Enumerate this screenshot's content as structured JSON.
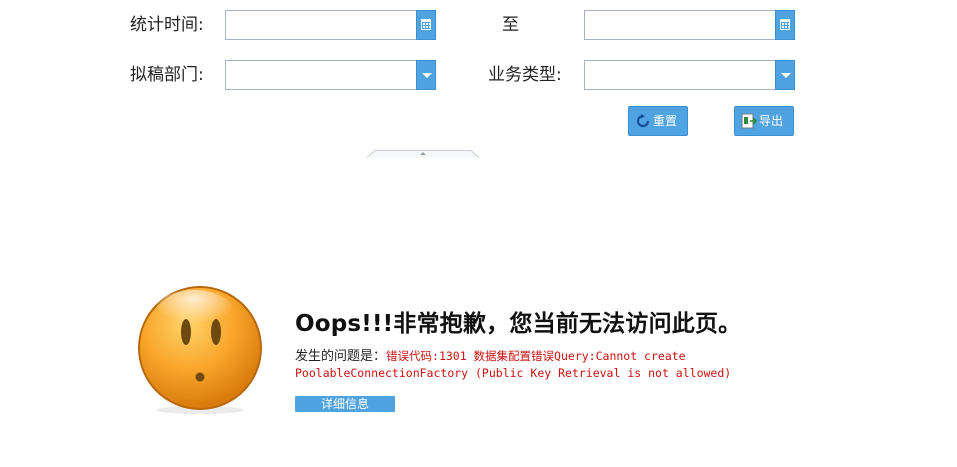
{
  "form": {
    "stat_time_label": "统计时间:",
    "to_label": "至",
    "dept_label": "拟稿部门:",
    "biz_type_label": "业务类型:",
    "start_date_value": "",
    "end_date_value": "",
    "dept_value": "",
    "biz_type_value": ""
  },
  "actions": {
    "reset_label": "重置",
    "export_label": "导出"
  },
  "error": {
    "title": "Oops!!!非常抱歉，您当前无法访问此页。",
    "problem_label": "发生的问题是：",
    "problem_text": "错误代码:1301 数据集配置错误Query:Cannot create PoolableConnectionFactory (Public Key Retrieval is not allowed)",
    "detail_button": "详细信息"
  },
  "colors": {
    "accent": "#4fa3e0",
    "error_text": "#cc1111"
  },
  "icons": {
    "calendar": "calendar-icon",
    "dropdown": "chevron-down-icon",
    "reset": "refresh-icon",
    "export": "export-icon",
    "collapse": "collapse-up-icon",
    "face": "surprised-face-icon"
  }
}
